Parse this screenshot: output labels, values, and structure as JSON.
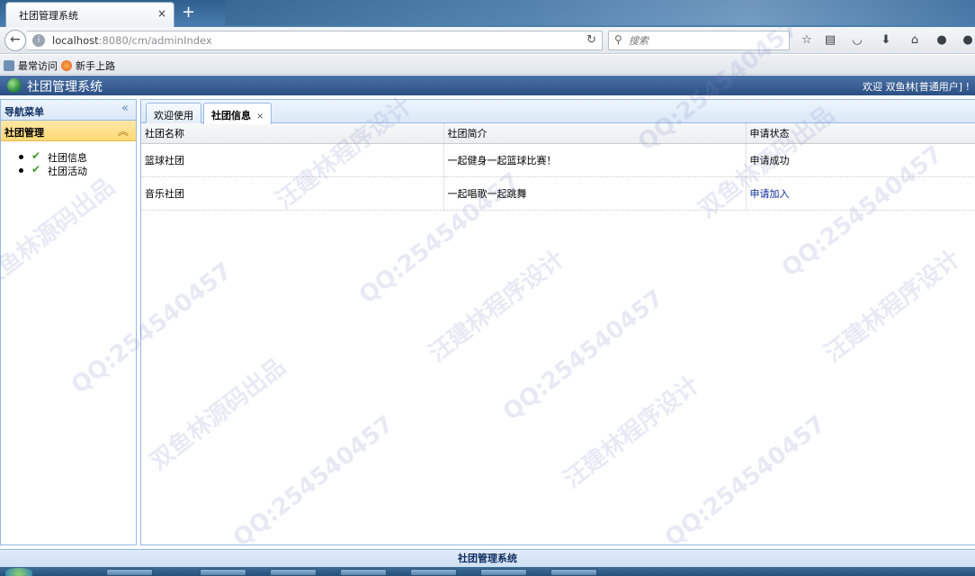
{
  "browser": {
    "tab_title": "社团管理系统",
    "tab_close": "×",
    "new_tab": "+",
    "url_host": "localhost",
    "url_path": ":8080/cm/adminIndex",
    "search_placeholder": "搜索",
    "bookmarks": [
      "最常访问",
      "新手上路"
    ]
  },
  "header": {
    "title": "社团管理系统",
    "welcome": "欢迎 双鱼林[普通用户] !"
  },
  "sidebar": {
    "title": "导航菜单",
    "collapse": "«",
    "section": "社团管理",
    "section_toggle": "︽",
    "items": [
      "社团信息",
      "社团活动"
    ]
  },
  "tabs": [
    {
      "label": "欢迎使用"
    },
    {
      "label": "社团信息",
      "close": "×"
    }
  ],
  "grid": {
    "columns": [
      "社团名称",
      "社团简介",
      "申请状态"
    ],
    "rows": [
      [
        "篮球社团",
        "一起健身一起篮球比赛！",
        "申请成功"
      ],
      [
        "音乐社团",
        "一起唱歌一起跳舞",
        "申请加入"
      ]
    ]
  },
  "footer": {
    "text": "社团管理系统"
  },
  "watermarks": [
    "QQ:254540457",
    "双鱼林源码出品",
    "汪建林程序设计"
  ]
}
